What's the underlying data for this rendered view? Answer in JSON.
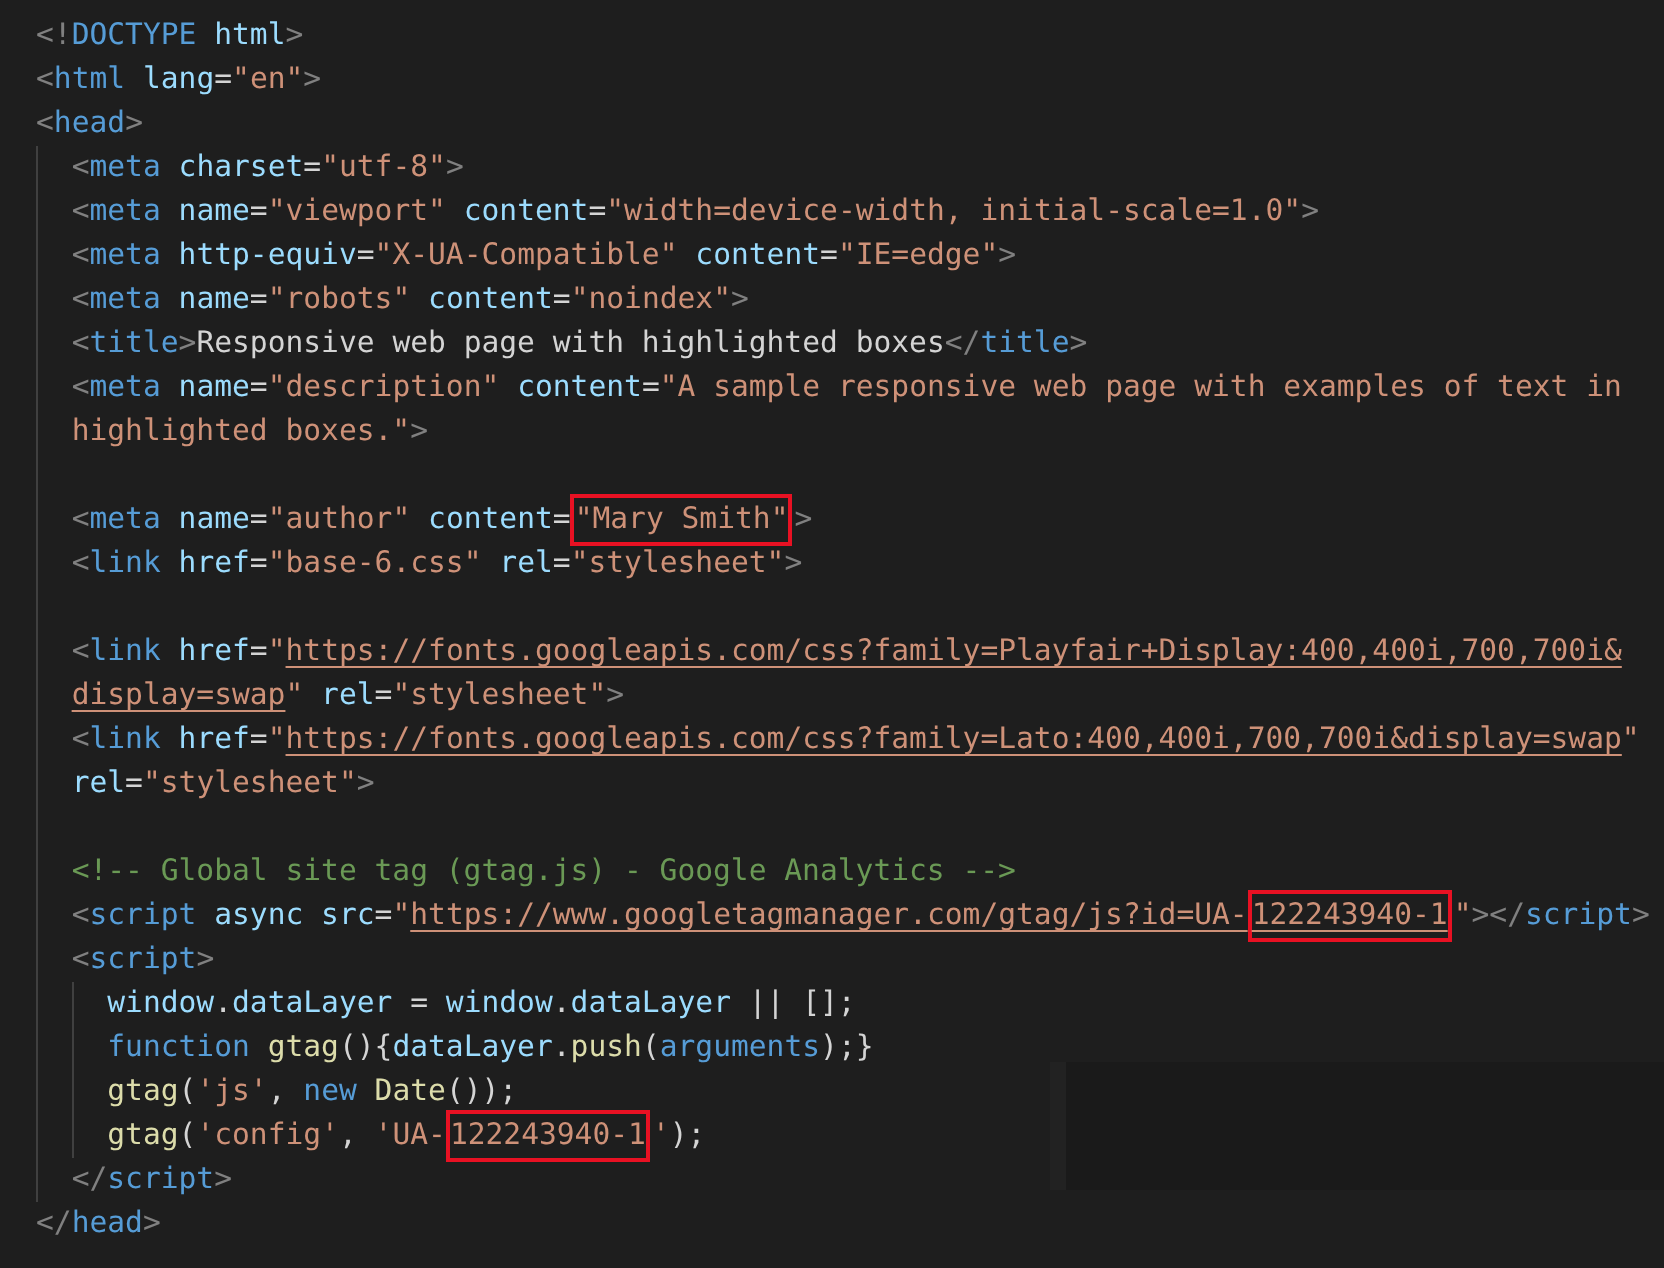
{
  "lines": [
    {
      "kind": "code",
      "tokens": [
        {
          "kind": "punct",
          "text": "<!"
        },
        {
          "kind": "tag",
          "text": "DOCTYPE"
        },
        {
          "kind": "attr",
          "text": " html"
        },
        {
          "kind": "punct",
          "text": ">"
        }
      ]
    },
    {
      "kind": "code",
      "tokens": [
        {
          "kind": "punct",
          "text": "<"
        },
        {
          "kind": "tag",
          "text": "html"
        },
        {
          "kind": "attr",
          "text": " lang"
        },
        {
          "kind": "plain",
          "text": "="
        },
        {
          "kind": "string",
          "text": "\"en\""
        },
        {
          "kind": "punct",
          "text": ">"
        }
      ]
    },
    {
      "kind": "code",
      "tokens": [
        {
          "kind": "punct",
          "text": "<"
        },
        {
          "kind": "tag",
          "text": "head"
        },
        {
          "kind": "punct",
          "text": ">"
        }
      ],
      "children": [
        {
          "kind": "code",
          "tokens": [
            {
              "kind": "punct",
              "text": "<"
            },
            {
              "kind": "tag",
              "text": "meta"
            },
            {
              "kind": "attr",
              "text": " charset"
            },
            {
              "kind": "plain",
              "text": "="
            },
            {
              "kind": "string",
              "text": "\"utf-8\""
            },
            {
              "kind": "punct",
              "text": ">"
            }
          ]
        },
        {
          "kind": "code",
          "tokens": [
            {
              "kind": "punct",
              "text": "<"
            },
            {
              "kind": "tag",
              "text": "meta"
            },
            {
              "kind": "attr",
              "text": " name"
            },
            {
              "kind": "plain",
              "text": "="
            },
            {
              "kind": "string",
              "text": "\"viewport\""
            },
            {
              "kind": "attr",
              "text": " content"
            },
            {
              "kind": "plain",
              "text": "="
            },
            {
              "kind": "string",
              "text": "\"width=device-width, initial-scale=1.0\""
            },
            {
              "kind": "punct",
              "text": ">"
            }
          ]
        },
        {
          "kind": "code",
          "tokens": [
            {
              "kind": "punct",
              "text": "<"
            },
            {
              "kind": "tag",
              "text": "meta"
            },
            {
              "kind": "attr",
              "text": " http-equiv"
            },
            {
              "kind": "plain",
              "text": "="
            },
            {
              "kind": "string",
              "text": "\"X-UA-Compatible\""
            },
            {
              "kind": "attr",
              "text": " content"
            },
            {
              "kind": "plain",
              "text": "="
            },
            {
              "kind": "string",
              "text": "\"IE=edge\""
            },
            {
              "kind": "punct",
              "text": ">"
            }
          ]
        },
        {
          "kind": "code",
          "tokens": [
            {
              "kind": "punct",
              "text": "<"
            },
            {
              "kind": "tag",
              "text": "meta"
            },
            {
              "kind": "attr",
              "text": " name"
            },
            {
              "kind": "plain",
              "text": "="
            },
            {
              "kind": "string",
              "text": "\"robots\""
            },
            {
              "kind": "attr",
              "text": " content"
            },
            {
              "kind": "plain",
              "text": "="
            },
            {
              "kind": "string",
              "text": "\"noindex\""
            },
            {
              "kind": "punct",
              "text": ">"
            }
          ]
        },
        {
          "kind": "code",
          "tokens": [
            {
              "kind": "punct",
              "text": "<"
            },
            {
              "kind": "tag",
              "text": "title"
            },
            {
              "kind": "punct",
              "text": ">"
            },
            {
              "kind": "plain",
              "text": "Responsive web page with highlighted boxes"
            },
            {
              "kind": "punct",
              "text": "</"
            },
            {
              "kind": "tag",
              "text": "title"
            },
            {
              "kind": "punct",
              "text": ">"
            }
          ]
        },
        {
          "kind": "code",
          "tokens": [
            {
              "kind": "punct",
              "text": "<"
            },
            {
              "kind": "tag",
              "text": "meta"
            },
            {
              "kind": "attr",
              "text": " name"
            },
            {
              "kind": "plain",
              "text": "="
            },
            {
              "kind": "string",
              "text": "\"description\""
            },
            {
              "kind": "attr",
              "text": " content"
            },
            {
              "kind": "plain",
              "text": "="
            },
            {
              "kind": "string",
              "text": "\"A sample responsive web page with examples of text in"
            }
          ]
        },
        {
          "kind": "code",
          "tokens": [
            {
              "kind": "string",
              "text": "highlighted boxes.\""
            },
            {
              "kind": "punct",
              "text": ">"
            }
          ]
        },
        {
          "kind": "blank"
        },
        {
          "kind": "code",
          "tokens": [
            {
              "kind": "punct",
              "text": "<"
            },
            {
              "kind": "tag",
              "text": "meta"
            },
            {
              "kind": "attr",
              "text": " name"
            },
            {
              "kind": "plain",
              "text": "="
            },
            {
              "kind": "string",
              "text": "\"author\""
            },
            {
              "kind": "attr",
              "text": " content"
            },
            {
              "kind": "plain",
              "text": "="
            },
            {
              "kind": "boxed_string",
              "text": "\"Mary Smith\""
            },
            {
              "kind": "punct",
              "text": ">"
            }
          ]
        },
        {
          "kind": "code",
          "tokens": [
            {
              "kind": "punct",
              "text": "<"
            },
            {
              "kind": "tag",
              "text": "link"
            },
            {
              "kind": "attr",
              "text": " href"
            },
            {
              "kind": "plain",
              "text": "="
            },
            {
              "kind": "string",
              "text": "\"base-6.css\""
            },
            {
              "kind": "attr",
              "text": " rel"
            },
            {
              "kind": "plain",
              "text": "="
            },
            {
              "kind": "string",
              "text": "\"stylesheet\""
            },
            {
              "kind": "punct",
              "text": ">"
            }
          ]
        },
        {
          "kind": "blank"
        },
        {
          "kind": "code",
          "tokens": [
            {
              "kind": "punct",
              "text": "<"
            },
            {
              "kind": "tag",
              "text": "link"
            },
            {
              "kind": "attr",
              "text": " href"
            },
            {
              "kind": "plain",
              "text": "="
            },
            {
              "kind": "string",
              "text": "\""
            },
            {
              "kind": "link",
              "text": "https://fonts.googleapis.com/css?family=Playfair+Display:400,400i,700,700i&"
            }
          ]
        },
        {
          "kind": "code",
          "tokens": [
            {
              "kind": "link",
              "text": "display=swap"
            },
            {
              "kind": "string",
              "text": "\""
            },
            {
              "kind": "attr",
              "text": " rel"
            },
            {
              "kind": "plain",
              "text": "="
            },
            {
              "kind": "string",
              "text": "\"stylesheet\""
            },
            {
              "kind": "punct",
              "text": ">"
            }
          ]
        },
        {
          "kind": "code",
          "tokens": [
            {
              "kind": "punct",
              "text": "<"
            },
            {
              "kind": "tag",
              "text": "link"
            },
            {
              "kind": "attr",
              "text": " href"
            },
            {
              "kind": "plain",
              "text": "="
            },
            {
              "kind": "string",
              "text": "\""
            },
            {
              "kind": "link",
              "text": "https://fonts.googleapis.com/css?family=Lato:400,400i,700,700i&display=swap"
            },
            {
              "kind": "string",
              "text": "\""
            }
          ]
        },
        {
          "kind": "code",
          "tokens": [
            {
              "kind": "attr",
              "text": "rel"
            },
            {
              "kind": "plain",
              "text": "="
            },
            {
              "kind": "string",
              "text": "\"stylesheet\""
            },
            {
              "kind": "punct",
              "text": ">"
            }
          ]
        },
        {
          "kind": "blank"
        },
        {
          "kind": "code",
          "tokens": [
            {
              "kind": "comment",
              "text": "<!-- Global site tag (gtag.js) - Google Analytics -->"
            }
          ]
        },
        {
          "kind": "code",
          "tokens": [
            {
              "kind": "punct",
              "text": "<"
            },
            {
              "kind": "tag",
              "text": "script"
            },
            {
              "kind": "attr",
              "text": " async src"
            },
            {
              "kind": "plain",
              "text": "="
            },
            {
              "kind": "string",
              "text": "\""
            },
            {
              "kind": "link",
              "text": "https://www.googletagmanager.com/gtag/js?id=UA-"
            },
            {
              "kind": "boxed_link",
              "text": "122243940-1"
            },
            {
              "kind": "string",
              "text": "\""
            },
            {
              "kind": "punct",
              "text": "></"
            },
            {
              "kind": "tag",
              "text": "script"
            },
            {
              "kind": "punct",
              "text": ">"
            }
          ]
        },
        {
          "kind": "code",
          "tokens": [
            {
              "kind": "punct",
              "text": "<"
            },
            {
              "kind": "tag",
              "text": "script"
            },
            {
              "kind": "punct",
              "text": ">"
            }
          ],
          "children": [
            {
              "kind": "code",
              "tokens": [
                {
                  "kind": "variable",
                  "text": "window"
                },
                {
                  "kind": "plain",
                  "text": "."
                },
                {
                  "kind": "variable",
                  "text": "dataLayer"
                },
                {
                  "kind": "plain",
                  "text": " = "
                },
                {
                  "kind": "variable",
                  "text": "window"
                },
                {
                  "kind": "plain",
                  "text": "."
                },
                {
                  "kind": "variable",
                  "text": "dataLayer"
                },
                {
                  "kind": "plain",
                  "text": " || [];"
                }
              ]
            },
            {
              "kind": "code",
              "tokens": [
                {
                  "kind": "keyword",
                  "text": "function"
                },
                {
                  "kind": "function",
                  "text": " gtag"
                },
                {
                  "kind": "plain",
                  "text": "(){"
                },
                {
                  "kind": "variable",
                  "text": "dataLayer"
                },
                {
                  "kind": "plain",
                  "text": "."
                },
                {
                  "kind": "function",
                  "text": "push"
                },
                {
                  "kind": "plain",
                  "text": "("
                },
                {
                  "kind": "keyword",
                  "text": "arguments"
                },
                {
                  "kind": "plain",
                  "text": ");}"
                }
              ]
            },
            {
              "kind": "code",
              "tokens": [
                {
                  "kind": "function",
                  "text": "gtag"
                },
                {
                  "kind": "plain",
                  "text": "("
                },
                {
                  "kind": "string",
                  "text": "'js'"
                },
                {
                  "kind": "plain",
                  "text": ", "
                },
                {
                  "kind": "keyword",
                  "text": "new"
                },
                {
                  "kind": "function",
                  "text": " Date"
                },
                {
                  "kind": "plain",
                  "text": "());"
                }
              ]
            },
            {
              "kind": "code",
              "tokens": [
                {
                  "kind": "function",
                  "text": "gtag"
                },
                {
                  "kind": "plain",
                  "text": "("
                },
                {
                  "kind": "string",
                  "text": "'config'"
                },
                {
                  "kind": "plain",
                  "text": ", "
                },
                {
                  "kind": "string",
                  "text": "'UA-"
                },
                {
                  "kind": "boxed_string",
                  "text": "122243940-1"
                },
                {
                  "kind": "string",
                  "text": "'"
                },
                {
                  "kind": "plain",
                  "text": ");"
                }
              ]
            }
          ]
        },
        {
          "kind": "code",
          "tokens": [
            {
              "kind": "punct",
              "text": "</"
            },
            {
              "kind": "tag",
              "text": "script"
            },
            {
              "kind": "punct",
              "text": ">"
            }
          ]
        }
      ]
    },
    {
      "kind": "code",
      "tokens": [
        {
          "kind": "punct",
          "text": "</"
        },
        {
          "kind": "tag",
          "text": "head"
        },
        {
          "kind": "punct",
          "text": ">"
        }
      ]
    }
  ]
}
